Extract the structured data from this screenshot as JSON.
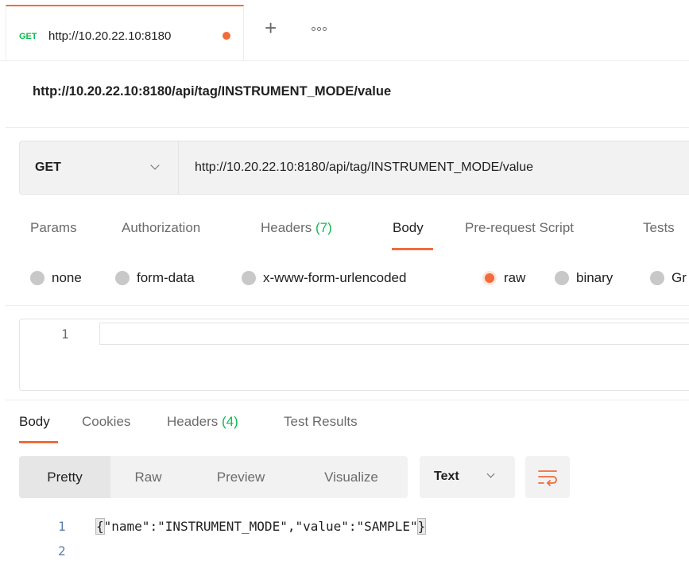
{
  "tab": {
    "method": "GET",
    "url": "http://10.20.22.10:8180",
    "add_label": "+",
    "more_icon": "more-options-icon"
  },
  "request": {
    "title": "http://10.20.22.10:8180/api/tag/INSTRUMENT_MODE/value",
    "method": "GET",
    "url": "http://10.20.22.10:8180/api/tag/INSTRUMENT_MODE/value",
    "tabs": [
      {
        "label": "Params"
      },
      {
        "label": "Authorization"
      },
      {
        "label": "Headers",
        "count": "(7)"
      },
      {
        "label": "Body"
      },
      {
        "label": "Pre-request Script"
      },
      {
        "label": "Tests"
      }
    ],
    "active_tab": "Body",
    "body_types": [
      {
        "label": "none"
      },
      {
        "label": "form-data"
      },
      {
        "label": "x-www-form-urlencoded"
      },
      {
        "label": "raw"
      },
      {
        "label": "binary"
      },
      {
        "label": "Gr"
      }
    ],
    "selected_body_type": "raw",
    "editor_line_number": "1"
  },
  "response": {
    "tabs": [
      {
        "label": "Body"
      },
      {
        "label": "Cookies"
      },
      {
        "label": "Headers",
        "count": "(4)"
      },
      {
        "label": "Test Results"
      }
    ],
    "active_tab": "Body",
    "view_modes": [
      "Pretty",
      "Raw",
      "Preview",
      "Visualize"
    ],
    "active_view": "Pretty",
    "language": "Text",
    "wrap_icon": "wrap-lines-icon",
    "lines": [
      {
        "num": "1",
        "open": "{",
        "content": "\"name\":\"INSTRUMENT_MODE\",\"value\":\"SAMPLE\"",
        "close": "}"
      },
      {
        "num": "2",
        "open": "",
        "content": "",
        "close": ""
      }
    ]
  },
  "colors": {
    "accent": "#f26b3a",
    "green": "#0cbb52",
    "panel": "#f2f2f2"
  }
}
